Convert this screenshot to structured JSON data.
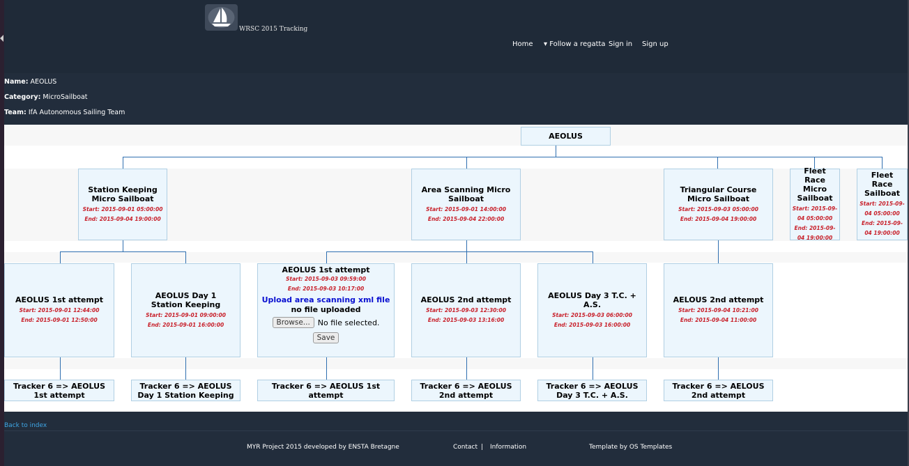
{
  "site": {
    "title": "WRSC 2015 Tracking"
  },
  "nav": {
    "home": "Home",
    "follow": "Follow a regatta",
    "signin": "Sign in",
    "signup": "Sign up"
  },
  "boat": {
    "name_label": "Name:",
    "name": "AEOLUS",
    "category_label": "Category:",
    "category": "MicroSailboat",
    "team_label": "Team:",
    "team": "IfA Autonomous Sailing Team"
  },
  "tree": {
    "root": "AEOLUS",
    "races": [
      {
        "title": "Station Keeping Micro Sailboat",
        "start": "Start: 2015-09-01 05:00:00",
        "end": "End: 2015-09-04 19:00:00"
      },
      {
        "title": "Area Scanning Micro Sailboat",
        "start": "Start: 2015-09-01 14:00:00",
        "end": "End: 2015-09-04 22:00:00"
      },
      {
        "title": "Triangular Course Micro Sailboat",
        "start": "Start: 2015-09-03 05:00:00",
        "end": "End: 2015-09-04 19:00:00"
      },
      {
        "title": "Fleet Race Micro Sailboat",
        "start": "Start: 2015-09-04 05:00:00",
        "end": "End: 2015-09-04 19:00:00"
      },
      {
        "title": "Fleet Race Sailboat",
        "start": "Start: 2015-09-04 05:00:00",
        "end": "End: 2015-09-04 19:00:00"
      }
    ],
    "attempts": [
      {
        "title": "AEOLUS 1st attempt",
        "start": "Start: 2015-09-01 12:44:00",
        "end": "End: 2015-09-01 12:50:00"
      },
      {
        "title": "AEOLUS Day 1 Station Keeping",
        "start": "Start: 2015-09-01 09:00:00",
        "end": "End: 2015-09-01 16:00:00"
      },
      {
        "title": "AEOLUS 1st attempt",
        "start": "Start: 2015-09-03 09:59:00",
        "end": "End: 2015-09-03 10:17:00",
        "upload_link": "Upload area scanning xml file",
        "upload_status": "no file uploaded",
        "browse_label": "Browse...",
        "file_status": "No file selected.",
        "save_label": "Save"
      },
      {
        "title": "AEOLUS 2nd attempt",
        "start": "Start: 2015-09-03 12:30:00",
        "end": "End: 2015-09-03 13:16:00"
      },
      {
        "title": "AEOLUS Day 3 T.C. + A.S.",
        "start": "Start: 2015-09-03 06:00:00",
        "end": "End: 2015-09-03 16:00:00"
      },
      {
        "title": "AELOUS 2nd attempt",
        "start": "Start: 2015-09-04 10:21:00",
        "end": "End: 2015-09-04 11:00:00"
      }
    ],
    "trackers": [
      "Tracker 6 => AEOLUS 1st attempt",
      "Tracker 6 => AEOLUS Day 1 Station Keeping",
      "Tracker 6 => AEOLUS 1st attempt",
      "Tracker 6 => AEOLUS 2nd attempt",
      "Tracker 6 => AEOLUS Day 3 T.C. + A.S.",
      "Tracker 6 => AELOUS 2nd attempt"
    ]
  },
  "links": {
    "back": "Back to index"
  },
  "footer": {
    "credit": "MYR Project 2015 developed by ENSTA Bretagne",
    "contact": "Contact",
    "separator": "|",
    "information": "Information",
    "template": "Template by OS Templates"
  },
  "colors": {
    "header_bg": "#1f2a38",
    "node_bg": "#ecf6fd",
    "date_red": "#c8202a",
    "link_blue": "#0a10d0",
    "connector": "#2f6fb0"
  },
  "icons": {
    "logo": "sailboat-logo-icon",
    "dropdown": "caret-down-icon"
  }
}
